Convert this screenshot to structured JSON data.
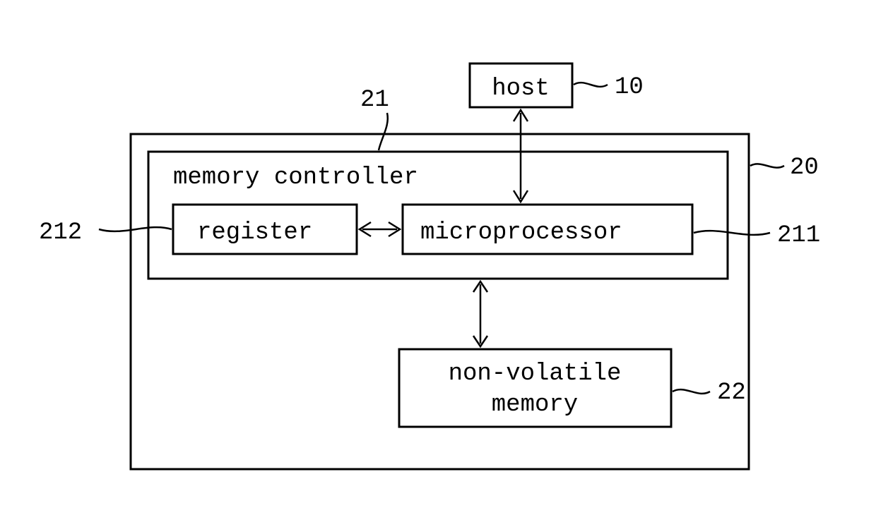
{
  "blocks": {
    "host": {
      "label": "host",
      "ref": "10"
    },
    "system": {
      "ref": "20"
    },
    "memory_controller": {
      "label": "memory controller",
      "ref": "21"
    },
    "register": {
      "label": "register",
      "ref": "212"
    },
    "microprocessor": {
      "label": "microprocessor",
      "ref": "211"
    },
    "nonvolatile_memory": {
      "line1": "non-volatile",
      "line2": "memory",
      "ref": "22"
    }
  }
}
